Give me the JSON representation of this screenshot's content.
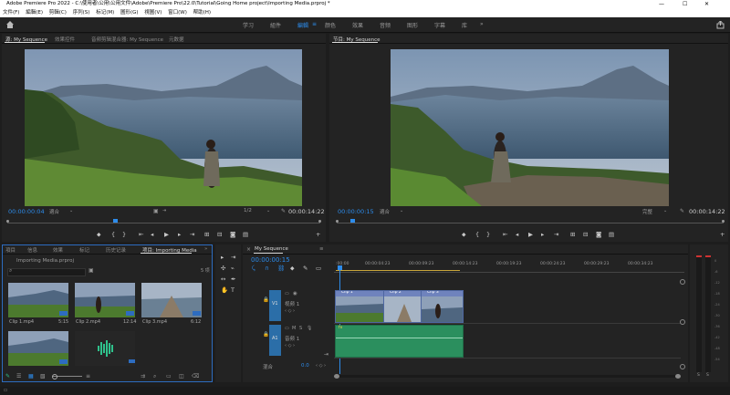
{
  "window": {
    "title": "Adobe Premiere Pro 2022 - C:\\使用者\\公用\\公用文件\\Adobe\\Premiere Pro\\22.0\\Tutorial\\Going Home project\\Importing Media.prproj *",
    "minimize": "—",
    "maximize": "☐",
    "close": "✕"
  },
  "menu": [
    "文件(F)",
    "編輯(E)",
    "剪輯(C)",
    "序列(S)",
    "标记(M)",
    "圖形(G)",
    "視圖(V)",
    "窗口(W)",
    "帮助(H)"
  ],
  "workspaces": {
    "items": [
      "学习",
      "組件",
      "編輯",
      "颜色",
      "效果",
      "音频",
      "图形",
      "字幕",
      "库"
    ],
    "active": "編輯",
    "menu_icon": "≡",
    "more": "»"
  },
  "source_monitor": {
    "tabs": [
      "源: My Sequence",
      "效果控件",
      "音频剪辑混合器: My Sequence",
      "元数据"
    ],
    "timecode": "00:00:00:04",
    "fit": "適合",
    "ratio": "1/2",
    "duration": "00:00:14:22"
  },
  "program_monitor": {
    "tab": "节目: My Sequence",
    "timecode": "00:00:00:15",
    "fit": "適合",
    "quality": "完整",
    "duration": "00:00:14:22"
  },
  "project": {
    "tabs": [
      "項目",
      "信息",
      "效果",
      "标记",
      "历史记录",
      "项目: Importing Media"
    ],
    "file": "Importing Media.prproj",
    "count": "5 项",
    "clips": [
      {
        "name": "Clip 1.mp4",
        "duration": "5:15"
      },
      {
        "name": "Clip 2.mp4",
        "duration": "12:14"
      },
      {
        "name": "Clip 3.mp4",
        "duration": "6:12"
      },
      {
        "name": "",
        "duration": ""
      },
      {
        "name": "",
        "duration": ""
      }
    ]
  },
  "timeline": {
    "tab": "My Sequence",
    "timecode": "00:00:00:15",
    "ruler": [
      ":00:00",
      "00:00:04:23",
      "00:00:09:23",
      "00:00:14:23",
      "00:00:19:23",
      "00:00:24:23",
      "00:00:29:23",
      "00:00:34:23"
    ],
    "tracks": {
      "v1": {
        "name": "V1",
        "label": "视频 1"
      },
      "a1": {
        "name": "A1",
        "label": "音频 1"
      },
      "master": {
        "label": "混合",
        "value": "0.0"
      }
    },
    "clips": [
      "Clip 1",
      "Clip 2",
      "Clip 3"
    ],
    "audio_clip_label": "fx"
  },
  "meters": {
    "labels": [
      "S",
      "S"
    ],
    "scale": [
      "0",
      "-6",
      "-12",
      "-18",
      "-24",
      "-30",
      "-36",
      "-42",
      "-48",
      "-54",
      "dB"
    ]
  }
}
